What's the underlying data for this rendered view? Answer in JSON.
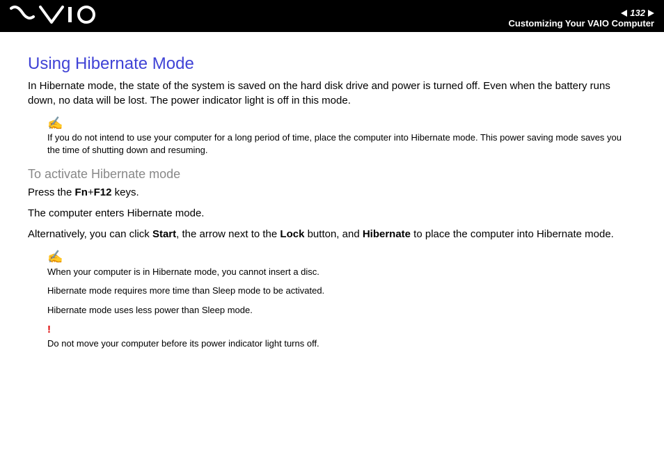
{
  "header": {
    "page_number": "132",
    "breadcrumb": "Customizing Your VAIO Computer"
  },
  "title": "Using Hibernate Mode",
  "intro": "In Hibernate mode, the state of the system is saved on the hard disk drive and power is turned off. Even when the battery runs down, no data will be lost. The power indicator light is off in this mode.",
  "note1": "If you do not intend to use your computer for a long period of time, place the computer into Hibernate mode. This power saving mode saves you the time of shutting down and resuming.",
  "subtitle": "To activate Hibernate mode",
  "step1_pre": "Press the ",
  "step1_key1": "Fn",
  "step1_plus": "+",
  "step1_key2": "F12",
  "step1_post": " keys.",
  "step2": "The computer enters Hibernate mode.",
  "step3_pre": "Alternatively, you can click ",
  "step3_b1": "Start",
  "step3_mid1": ", the arrow next to the ",
  "step3_b2": "Lock",
  "step3_mid2": " button, and ",
  "step3_b3": "Hibernate",
  "step3_post": " to place the computer into Hibernate mode.",
  "note2a": "When your computer is in Hibernate mode, you cannot insert a disc.",
  "note2b": "Hibernate mode requires more time than Sleep mode to be activated.",
  "note2c": "Hibernate mode uses less power than Sleep mode.",
  "warn_icon": "!",
  "warn": "Do not move your computer before its power indicator light turns off."
}
